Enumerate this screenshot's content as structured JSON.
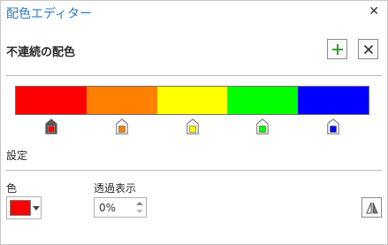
{
  "window": {
    "title": "配色エディター",
    "close_glyph": "✕"
  },
  "section": {
    "title": "不連続の配色"
  },
  "toolbar": {
    "add_icon": "plus-icon",
    "remove_icon": "x-icon"
  },
  "ramp": {
    "colors": [
      "#ff0000",
      "#ff8000",
      "#ffff00",
      "#00ff00",
      "#0000ff"
    ]
  },
  "stops": [
    {
      "color": "#ff0000",
      "selected": true
    },
    {
      "color": "#ff8000",
      "selected": false
    },
    {
      "color": "#ffff00",
      "selected": false
    },
    {
      "color": "#00ff00",
      "selected": false
    },
    {
      "color": "#0000ff",
      "selected": false
    }
  ],
  "settings": {
    "label": "設定"
  },
  "color_field": {
    "label": "色",
    "value": "#ff0000"
  },
  "transparency": {
    "label": "透過表示",
    "value": "0%"
  },
  "flip_button": {
    "icon": "flip-icon"
  }
}
